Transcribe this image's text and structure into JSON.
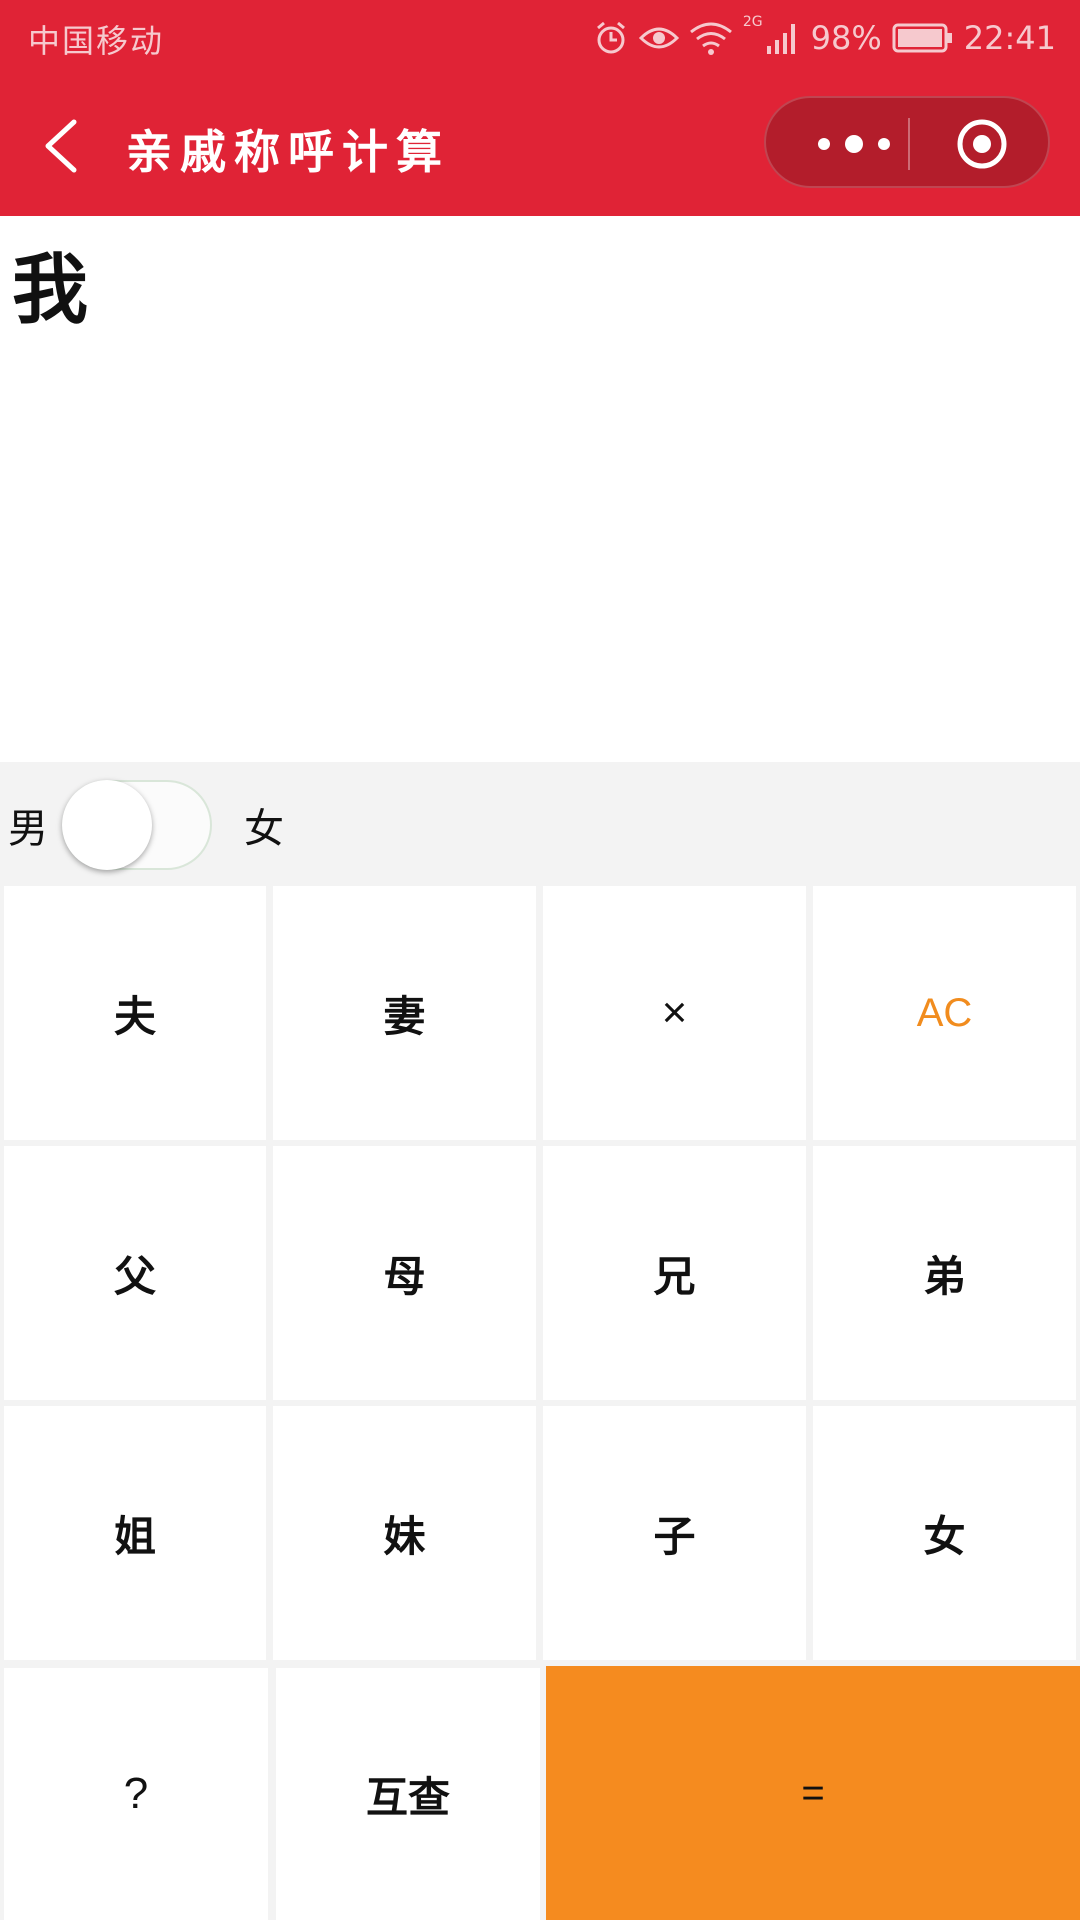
{
  "status_bar": {
    "carrier": "中国移动",
    "network": "2G",
    "battery": "98%",
    "time": "22:41",
    "icons": [
      "alarm-icon",
      "eye-icon",
      "wifi-icon",
      "signal-icon",
      "battery-icon"
    ]
  },
  "nav": {
    "title": "亲戚称呼计算",
    "back_icon": "chevron-left-icon",
    "more_icon": "more-dots-icon",
    "close_icon": "target-close-icon"
  },
  "display": {
    "text": "我"
  },
  "gender": {
    "male_label": "男",
    "female_label": "女",
    "selected": "男"
  },
  "keys": {
    "husband": "夫",
    "wife": "妻",
    "delete": "×",
    "clear": "AC",
    "father": "父",
    "mother": "母",
    "elder_brother": "兄",
    "younger_brother": "弟",
    "elder_sister": "姐",
    "younger_sister": "妹",
    "son": "子",
    "daughter": "女",
    "question": "?",
    "mutual": "互查",
    "equals": "="
  },
  "colors": {
    "brand_red": "#e02336",
    "accent_orange": "#f58b1f",
    "ac_orange": "#f18c1e"
  }
}
